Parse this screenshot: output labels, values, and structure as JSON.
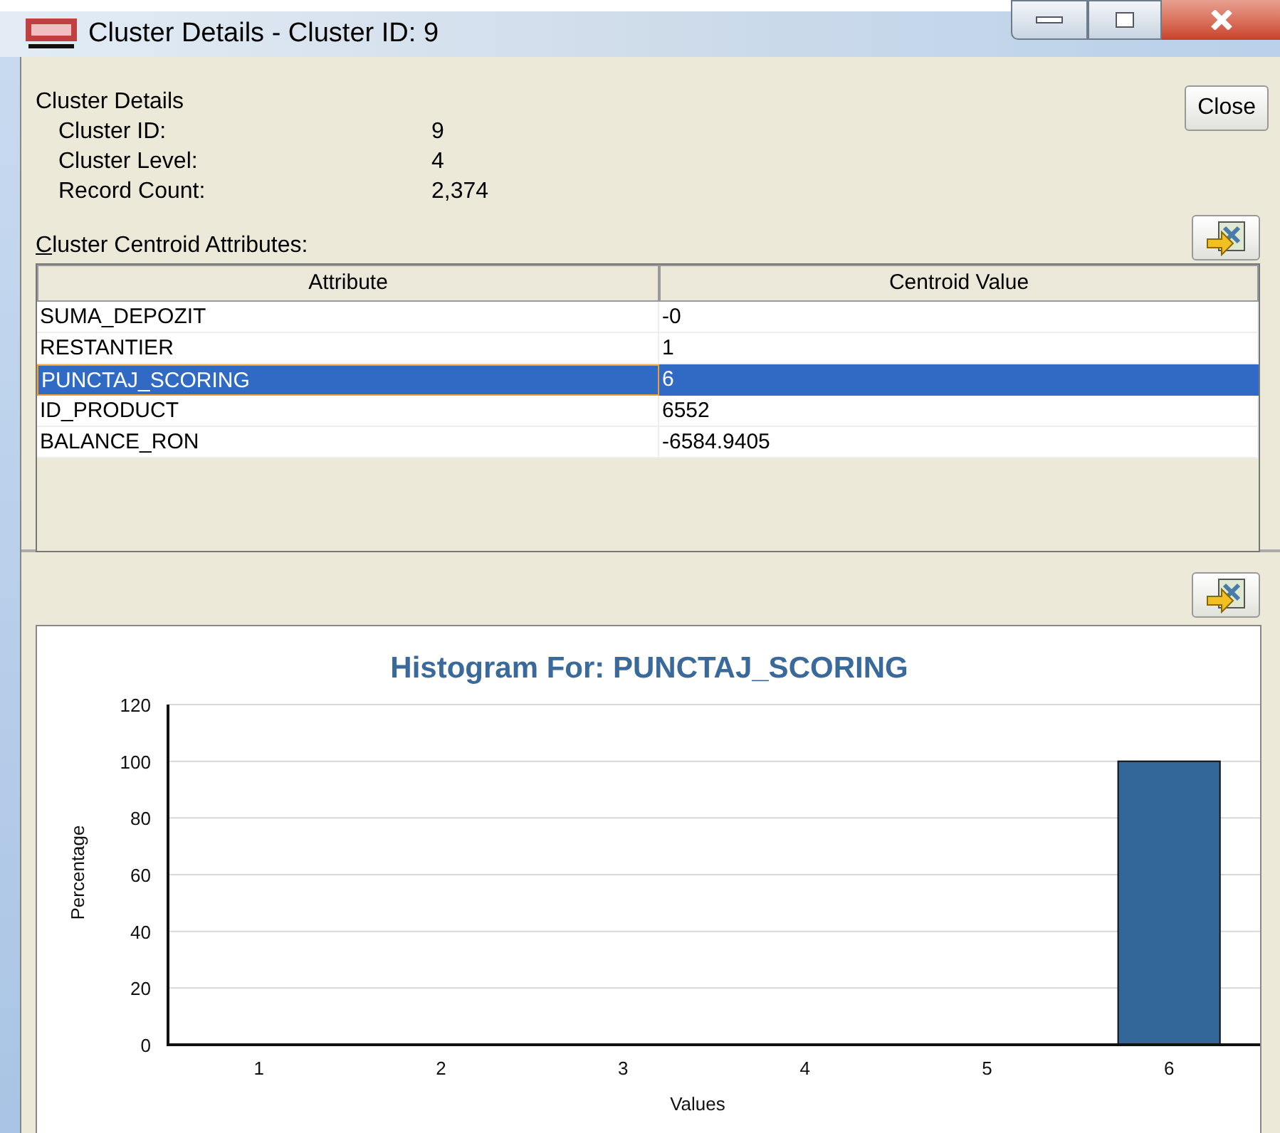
{
  "window": {
    "title": "Cluster Details - Cluster ID: 9"
  },
  "details": {
    "heading": "Cluster Details",
    "fields": [
      {
        "label": "Cluster ID:",
        "value": "9"
      },
      {
        "label": "Cluster Level:",
        "value": "4"
      },
      {
        "label": "Record Count:",
        "value": "2,374"
      }
    ]
  },
  "close_button": "Close",
  "table": {
    "label_key": "C",
    "label_rest": "luster Centroid Attributes:",
    "columns": [
      "Attribute",
      "Centroid Value"
    ],
    "rows": [
      {
        "attribute": "SUMA_DEPOZIT",
        "value": "-0",
        "selected": false
      },
      {
        "attribute": "RESTANTIER",
        "value": "1",
        "selected": false
      },
      {
        "attribute": "PUNCTAJ_SCORING",
        "value": "6",
        "selected": true
      },
      {
        "attribute": "ID_PRODUCT",
        "value": "6552",
        "selected": false
      },
      {
        "attribute": "BALANCE_RON",
        "value": "-6584.9405",
        "selected": false
      }
    ]
  },
  "histogram": {
    "chart_data": {
      "type": "bar",
      "title": "Histogram For: PUNCTAJ_SCORING",
      "xlabel": "Values",
      "ylabel": "Percentage",
      "categories": [
        "1",
        "2",
        "3",
        "4",
        "5",
        "6"
      ],
      "values": [
        0,
        0,
        0,
        0,
        0,
        100
      ],
      "grid": true,
      "ylim": [
        0,
        120
      ],
      "yticks": [
        0,
        20,
        40,
        60,
        80,
        100,
        120
      ]
    }
  }
}
